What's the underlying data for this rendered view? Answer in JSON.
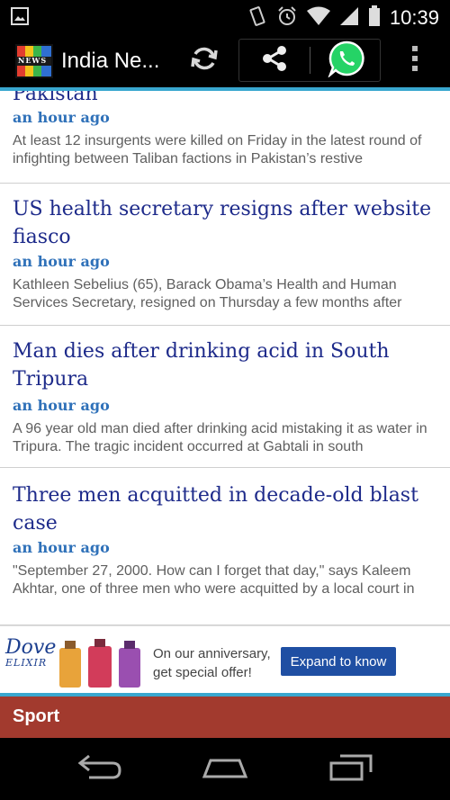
{
  "status_bar": {
    "time": "10:39",
    "icons": [
      "image-notification-icon",
      "vibrate-icon",
      "alarm-icon",
      "wifi-icon",
      "cellular-signal-icon",
      "battery-icon"
    ]
  },
  "action_bar": {
    "logo_text": "NEWS",
    "title": "India Ne...",
    "actions": [
      "refresh-icon",
      "share-icon",
      "whatsapp-icon",
      "overflow-menu-icon"
    ]
  },
  "articles": [
    {
      "headline": "Pakistan",
      "time": "an hour ago",
      "summary": "At least 12 insurgents were killed on Friday in the latest round of infighting between Taliban factions in Pakistan’s restive"
    },
    {
      "headline": "US health secretary resigns after website fiasco",
      "time": "an hour ago",
      "summary": "Kathleen Sebelius (65), Barack Obama’s Health and Human Services Secretary, resigned on Thursday a few months after"
    },
    {
      "headline": "Man dies after drinking acid in South Tripura",
      "time": "an hour ago",
      "summary": "A 96 year old man died after drinking acid mistaking it as water in Tripura. The tragic incident occurred at Gabtali in south"
    },
    {
      "headline": "Three men acquitted in decade-old blast case",
      "time": "an hour ago",
      "summary": "\"September 27, 2000. How can I forget that day,\" says Kaleem Akhtar, one of three men who were acquitted by a local court in"
    }
  ],
  "ad": {
    "brand_line1": "Dove",
    "brand_line2": "ELIXIR",
    "text_line1": "On our anniversary,",
    "text_line2": "get special offer!",
    "cta": "Expand to know"
  },
  "section": {
    "label": "Sport"
  },
  "colors": {
    "accent": "#39a7cf",
    "headline": "#1d2a8a",
    "time": "#2f71b9",
    "section_bar": "#a23a2e",
    "whatsapp": "#25d366"
  }
}
